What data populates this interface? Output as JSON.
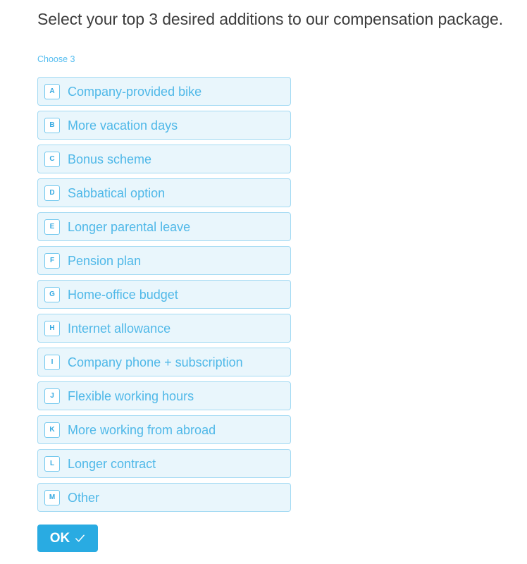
{
  "survey": {
    "title": "Select your top 3 desired additions to our compensation package.",
    "hint": "Choose 3",
    "options": [
      {
        "key": "A",
        "label": "Company-provided bike"
      },
      {
        "key": "B",
        "label": "More vacation days"
      },
      {
        "key": "C",
        "label": "Bonus scheme"
      },
      {
        "key": "D",
        "label": "Sabbatical option"
      },
      {
        "key": "E",
        "label": "Longer parental leave"
      },
      {
        "key": "F",
        "label": "Pension plan"
      },
      {
        "key": "G",
        "label": "Home-office budget"
      },
      {
        "key": "H",
        "label": "Internet allowance"
      },
      {
        "key": "I",
        "label": "Company phone + subscription"
      },
      {
        "key": "J",
        "label": "Flexible working hours"
      },
      {
        "key": "K",
        "label": "More working from abroad"
      },
      {
        "key": "L",
        "label": "Longer contract"
      },
      {
        "key": "M",
        "label": "Other"
      }
    ],
    "submit": {
      "label": "OK",
      "icon": "check-icon"
    }
  },
  "colors": {
    "accent": "#29abe2",
    "option_text": "#4fb8e8",
    "option_fill": "#e9f6fc",
    "option_border": "#a3daf3",
    "title_text": "#3c3c3c",
    "page_background": "#ffffff"
  }
}
